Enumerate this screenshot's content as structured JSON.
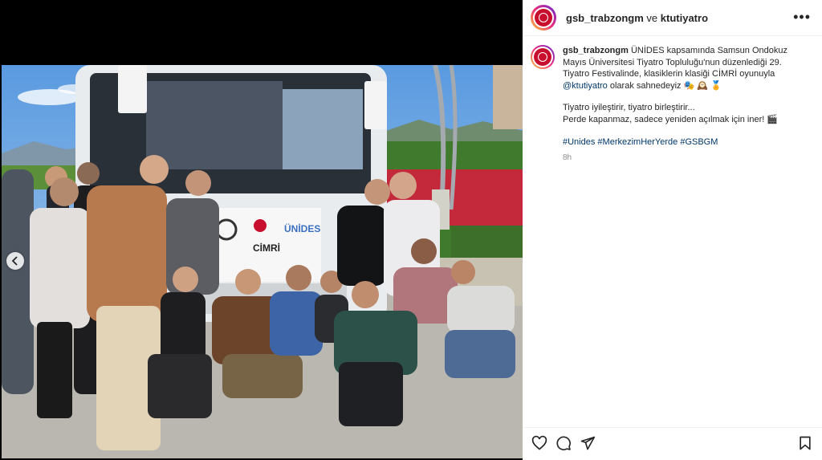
{
  "header": {
    "account": "gsb_trabzongm",
    "connector": "ve",
    "collaborator": "ktutiyatro",
    "more_icon": "more-horizontal-icon"
  },
  "caption": {
    "username": "gsb_trabzongm",
    "text_part1": "ÜNİDES kapsamında Samsun Ondokuz Mayıs Üniversitesi Tiyatro Topluluğu'nun düzenlediği 29. Tiyatro Festivalinde, klasiklerin klasiği CİMRİ oyunuyla",
    "mention": "@ktutiyatro",
    "text_part2": "olarak sahnedeyiz 🎭 🕰️ 🏅",
    "line2": "Tiyatro iyileştirir, tiyatro birleştirir...",
    "line3": "Perde kapanmaz, sadece yeniden açılmak için iner! 🎬",
    "hashtags": "#Unides #MerkezimHerYerde #GSBGM",
    "time": "8h"
  },
  "banner": {
    "title": "CİMRİ",
    "brand": "ÜNİDES"
  },
  "actions": {
    "like_icon": "heart-icon",
    "comment_icon": "comment-icon",
    "share_icon": "share-icon",
    "save_icon": "bookmark-icon"
  },
  "colors": {
    "link": "#00376b",
    "text": "#262626",
    "muted": "#8e8e8e",
    "brand_red": "#c8102e"
  }
}
